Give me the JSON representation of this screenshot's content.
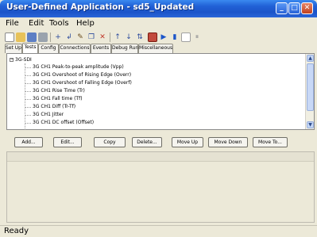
{
  "window": {
    "title": "User-Defined Application - sd5_Updated"
  },
  "menu": [
    "File",
    "Edit",
    "Tools",
    "Help"
  ],
  "toolbar": {
    "icons": [
      "new-icon",
      "open-icon",
      "save-icon",
      "print-icon",
      "add-icon",
      "insert-icon",
      "edit-icon",
      "copy-icon",
      "delete-icon",
      "move-up-icon",
      "move-down-icon",
      "sort-icon",
      "stop-icon",
      "run-icon",
      "step-icon",
      "record-icon",
      "pause-icon"
    ]
  },
  "tabs": [
    {
      "label": "Set Up"
    },
    {
      "label": "Tests"
    },
    {
      "label": "Config"
    },
    {
      "label": "Connections"
    },
    {
      "label": "Events"
    },
    {
      "label": "Debug Run"
    },
    {
      "label": "Miscellaneous"
    }
  ],
  "tree": {
    "root": "3G-SDI",
    "items": [
      "3G CH1 Peak-to-peak amplitude (Vpp)",
      "3G CH1 Overshoot of Rising Edge (Overr)",
      "3G CH1 Overshoot of Falling Edge (Overf)",
      "3G CH1 Rise Time (Tr)",
      "3G CH1 Fall time (Tf)",
      "3G CH1 Diff (Tr-Tf)",
      "3G CH1 Jitter",
      "3G CH1 DC offset (Offset)"
    ]
  },
  "buttons": {
    "add": "Add...",
    "edit": "Edit...",
    "copy": "Copy",
    "delete": "Delete...",
    "move_up": "Move Up",
    "move_down": "Move Down",
    "move_to": "Move To..."
  },
  "status": "Ready",
  "colors": {
    "titlebar": "#2161d6",
    "face": "#ECE9D8",
    "selected_tool": "#c24a3c"
  }
}
